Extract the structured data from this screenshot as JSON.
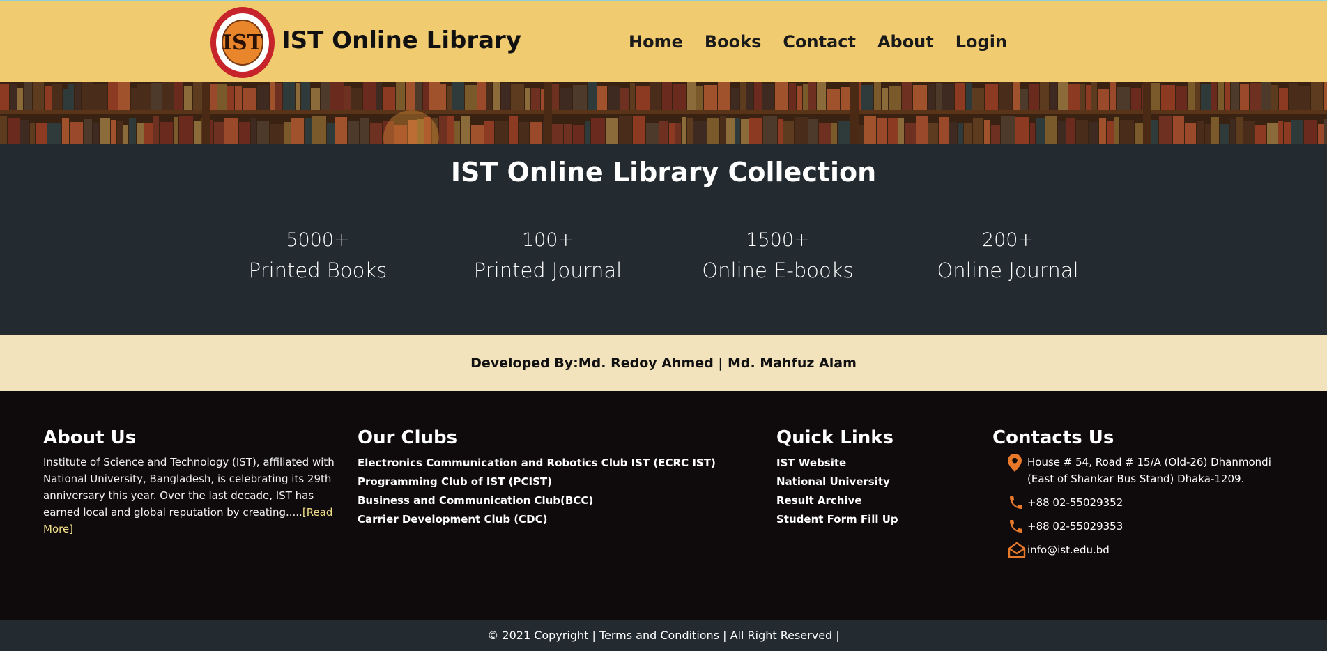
{
  "header": {
    "logo_text": "IST",
    "site_title": "IST Online Library",
    "nav": [
      "Home",
      "Books",
      "Contact",
      "About",
      "Login"
    ]
  },
  "collection": {
    "title": "IST Online Library Collection",
    "stats": [
      {
        "value": "5000+",
        "label": "Printed Books"
      },
      {
        "value": "100+",
        "label": "Printed Journal"
      },
      {
        "value": "1500+",
        "label": "Online E-books"
      },
      {
        "value": "200+",
        "label": "Online Journal"
      }
    ]
  },
  "developed_by": "Developed By:Md. Redoy Ahmed | Md. Mahfuz Alam",
  "footer": {
    "about": {
      "heading": "About Us",
      "text": "Institute of Science and Technology (IST), affiliated with National University, Bangladesh, is celebrating its 29th anniversary this year. Over the last decade, IST has earned local and global reputation by creating.....",
      "read_more": "[Read More]"
    },
    "clubs": {
      "heading": "Our Clubs",
      "items": [
        "Electronics Communication and Robotics Club IST (ECRC IST)",
        "Programming Club of IST (PCIST)",
        "Business and Communication Club(BCC)",
        "Carrier Development Club (CDC)"
      ]
    },
    "quick_links": {
      "heading": "Quick Links",
      "items": [
        "IST Website",
        "National University",
        "Result Archive",
        "Student Form Fill Up"
      ]
    },
    "contacts": {
      "heading": "Contacts Us",
      "address": "House # 54, Road # 15/A (Old-26) Dhanmondi (East of Shankar Bus Stand) Dhaka-1209.",
      "phone1": "+88 02-55029352",
      "phone2": "+88 02-55029353",
      "email": "info@ist.edu.bd"
    }
  },
  "copyright": "© 2021 Copyright | Terms and Conditions | All Right Reserved |",
  "colors": {
    "header_bg": "#f0cb70",
    "collection_bg": "#232b30",
    "devbar_bg": "#f3e3bd",
    "footer_bg": "#0f0b0c",
    "icon_accent": "#e8792a"
  }
}
